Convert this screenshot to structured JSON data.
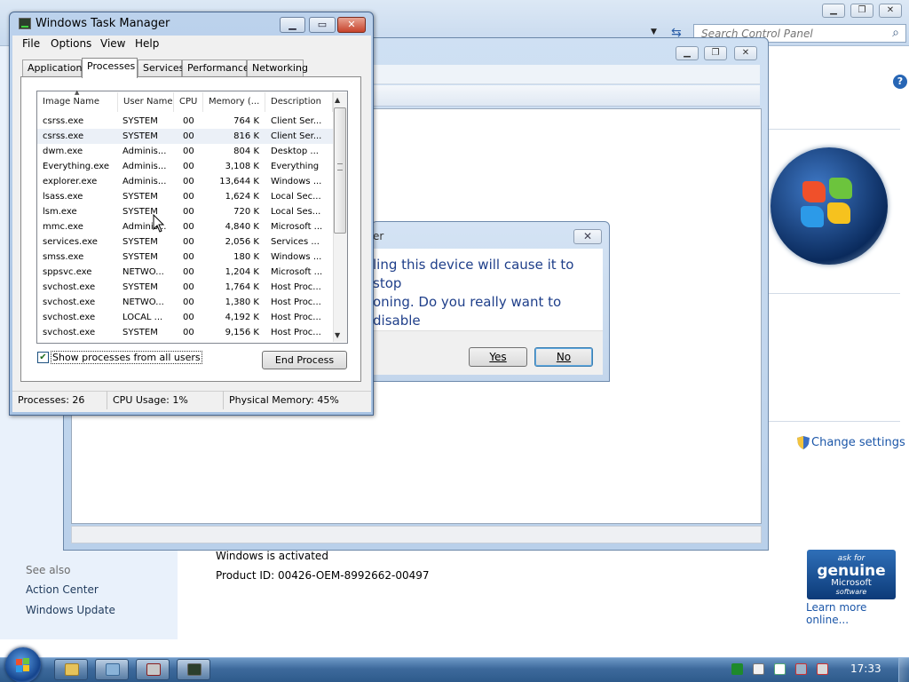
{
  "control_panel": {
    "search_placeholder": "Search Control Panel",
    "see_also": "See also",
    "action_center": "Action Center",
    "windows_update": "Windows Update",
    "activation_status": "Windows is activated",
    "product_id": "Product ID: 00426-OEM-8992662-00497",
    "change_settings": "Change settings",
    "genuine_line1": "ask for",
    "genuine_line2": "genuine",
    "genuine_line3": "Microsoft",
    "genuine_line4": "software",
    "learn_more": "Learn more online...",
    "help": "?"
  },
  "dialog": {
    "title": "er",
    "message_line1": "ling this device will cause it to stop",
    "message_line2": "oning. Do you really want to disable",
    "yes": "Yes",
    "no": "No",
    "close": "✕"
  },
  "task_manager": {
    "title": "Windows Task Manager",
    "menu": [
      "File",
      "Options",
      "View",
      "Help"
    ],
    "tabs": [
      "Applications",
      "Processes",
      "Services",
      "Performance",
      "Networking"
    ],
    "active_tab": "Processes",
    "columns": [
      "Image Name",
      "User Name",
      "CPU",
      "Memory (...",
      "Description"
    ],
    "processes": [
      {
        "image": "csrss.exe",
        "user": "SYSTEM",
        "cpu": "00",
        "memory": "764 K",
        "description": "Client Ser..."
      },
      {
        "image": "csrss.exe",
        "user": "SYSTEM",
        "cpu": "00",
        "memory": "816 K",
        "description": "Client Ser..."
      },
      {
        "image": "dwm.exe",
        "user": "Adminis...",
        "cpu": "00",
        "memory": "804 K",
        "description": "Desktop ..."
      },
      {
        "image": "Everything.exe",
        "user": "Adminis...",
        "cpu": "00",
        "memory": "3,108 K",
        "description": "Everything"
      },
      {
        "image": "explorer.exe",
        "user": "Adminis...",
        "cpu": "00",
        "memory": "13,644 K",
        "description": "Windows ..."
      },
      {
        "image": "lsass.exe",
        "user": "SYSTEM",
        "cpu": "00",
        "memory": "1,624 K",
        "description": "Local Sec..."
      },
      {
        "image": "lsm.exe",
        "user": "SYSTEM",
        "cpu": "00",
        "memory": "720 K",
        "description": "Local Ses..."
      },
      {
        "image": "mmc.exe",
        "user": "Adminis...",
        "cpu": "00",
        "memory": "4,840 K",
        "description": "Microsoft ..."
      },
      {
        "image": "services.exe",
        "user": "SYSTEM",
        "cpu": "00",
        "memory": "2,056 K",
        "description": "Services ..."
      },
      {
        "image": "smss.exe",
        "user": "SYSTEM",
        "cpu": "00",
        "memory": "180 K",
        "description": "Windows ..."
      },
      {
        "image": "sppsvc.exe",
        "user": "NETWO...",
        "cpu": "00",
        "memory": "1,204 K",
        "description": "Microsoft ..."
      },
      {
        "image": "svchost.exe",
        "user": "SYSTEM",
        "cpu": "00",
        "memory": "1,764 K",
        "description": "Host Proc..."
      },
      {
        "image": "svchost.exe",
        "user": "NETWO...",
        "cpu": "00",
        "memory": "1,380 K",
        "description": "Host Proc..."
      },
      {
        "image": "svchost.exe",
        "user": "LOCAL ...",
        "cpu": "00",
        "memory": "4,192 K",
        "description": "Host Proc..."
      },
      {
        "image": "svchost.exe",
        "user": "SYSTEM",
        "cpu": "00",
        "memory": "9,156 K",
        "description": "Host Proc..."
      }
    ],
    "show_all_users": "Show processes from all users",
    "show_all_checked": true,
    "end_process": "End Process",
    "status": {
      "processes": "Processes: 26",
      "cpu": "CPU Usage: 1%",
      "memory": "Physical Memory: 45%"
    }
  },
  "taskbar": {
    "clock": "17:33"
  }
}
